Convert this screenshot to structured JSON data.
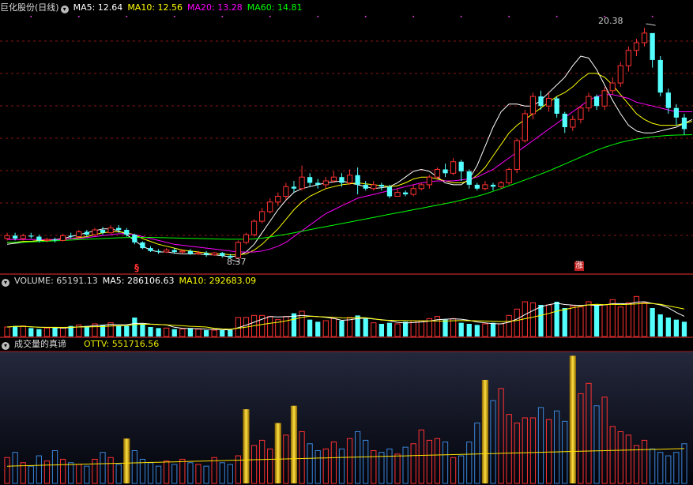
{
  "stock": {
    "name": "巨化股份",
    "period": "(日线)"
  },
  "ma": {
    "ma5": "MA5: 12.64",
    "ma10": "MA10: 12.56",
    "ma20": "MA20: 13.28",
    "ma60": "MA60: 14.81"
  },
  "price_marks": {
    "high": "20.38",
    "low": "8.37",
    "signal_left": "§",
    "signal_right": "涨"
  },
  "volume_panel": {
    "volume": "VOLUME: 65191.13",
    "ma5": "MA5: 286106.63",
    "ma10": "MA10: 292683.09"
  },
  "ind_panel": {
    "title": "成交量的真谛",
    "ottv": "OTTV: 551716.56"
  },
  "colors": {
    "up": "#ff3232",
    "down": "#54ffff",
    "ma5": "#ffffff",
    "ma10": "#ffff00",
    "ma20": "#ff00ff",
    "ma60": "#00ff00",
    "ind_blue": "#3a86d8",
    "ind_gold": "#e8b400"
  },
  "chart_data": [
    {
      "type": "candlestick",
      "ylim": [
        8.0,
        21.0
      ],
      "overlays": [
        {
          "name": "MA5",
          "values": [
            9.1,
            9.15,
            9.2,
            9.25,
            9.3,
            9.3,
            9.35,
            9.4,
            9.5,
            9.6,
            9.7,
            9.8,
            9.9,
            9.9,
            9.8,
            9.6,
            9.3,
            9.0,
            8.8,
            8.7,
            8.7,
            8.65,
            8.6,
            8.6,
            8.6,
            8.55,
            8.55,
            8.5,
            8.45,
            8.5,
            8.7,
            9.1,
            9.7,
            10.3,
            10.9,
            11.4,
            11.8,
            12.0,
            12.1,
            12.2,
            12.3,
            12.35,
            12.4,
            12.3,
            12.2,
            12.1,
            12.0,
            12.05,
            12.1,
            12.3,
            12.6,
            12.9,
            13.0,
            12.9,
            12.6,
            12.3,
            12.2,
            12.2,
            12.5,
            13.2,
            14.2,
            15.2,
            16.0,
            16.4,
            16.4,
            16.3,
            16.3,
            16.6,
            17.0,
            17.4,
            17.8,
            18.4,
            18.9,
            18.8,
            18.2,
            17.4,
            16.6,
            15.9,
            15.3,
            15.0,
            14.9,
            14.9,
            15.0,
            15.1,
            15.2,
            15.4,
            15.6
          ]
        },
        {
          "name": "MA10",
          "values": [
            9.2,
            9.2,
            9.25,
            9.25,
            9.3,
            9.3,
            9.35,
            9.35,
            9.4,
            9.45,
            9.5,
            9.6,
            9.7,
            9.75,
            9.75,
            9.7,
            9.6,
            9.4,
            9.25,
            9.1,
            9.0,
            8.9,
            8.8,
            8.75,
            8.7,
            8.65,
            8.6,
            8.6,
            8.55,
            8.55,
            8.6,
            8.8,
            9.1,
            9.5,
            9.9,
            10.4,
            10.9,
            11.3,
            11.6,
            11.8,
            12.0,
            12.1,
            12.2,
            12.25,
            12.3,
            12.25,
            12.2,
            12.15,
            12.1,
            12.15,
            12.3,
            12.5,
            12.6,
            12.6,
            12.5,
            12.4,
            12.3,
            12.3,
            12.4,
            12.7,
            13.1,
            13.7,
            14.3,
            14.9,
            15.3,
            15.6,
            15.9,
            16.2,
            16.5,
            16.8,
            17.0,
            17.3,
            17.7,
            18.0,
            18.0,
            17.8,
            17.4,
            16.9,
            16.4,
            15.9,
            15.6,
            15.4,
            15.3,
            15.3,
            15.3,
            15.4,
            15.5
          ]
        },
        {
          "name": "MA20",
          "values": [
            9.35,
            9.35,
            9.35,
            9.35,
            9.35,
            9.35,
            9.35,
            9.35,
            9.4,
            9.4,
            9.45,
            9.5,
            9.55,
            9.6,
            9.65,
            9.65,
            9.6,
            9.5,
            9.4,
            9.3,
            9.2,
            9.1,
            9.05,
            9.0,
            8.95,
            8.9,
            8.85,
            8.8,
            8.75,
            8.7,
            8.7,
            8.7,
            8.75,
            8.85,
            9.0,
            9.2,
            9.5,
            9.8,
            10.1,
            10.4,
            10.7,
            10.9,
            11.1,
            11.3,
            11.5,
            11.6,
            11.7,
            11.8,
            11.9,
            12.0,
            12.1,
            12.2,
            12.3,
            12.35,
            12.4,
            12.4,
            12.4,
            12.45,
            12.5,
            12.6,
            12.8,
            13.0,
            13.3,
            13.6,
            13.9,
            14.2,
            14.5,
            14.8,
            15.1,
            15.4,
            15.7,
            16.0,
            16.3,
            16.6,
            16.8,
            16.9,
            16.9,
            16.8,
            16.7,
            16.5,
            16.4,
            16.3,
            16.2,
            16.1,
            16.0,
            16.0,
            16.0
          ]
        },
        {
          "name": "MA60",
          "values": [
            9.2,
            9.2,
            9.2,
            9.22,
            9.24,
            9.26,
            9.28,
            9.3,
            9.32,
            9.34,
            9.36,
            9.38,
            9.4,
            9.42,
            9.44,
            9.45,
            9.46,
            9.46,
            9.46,
            9.45,
            9.44,
            9.43,
            9.42,
            9.41,
            9.4,
            9.39,
            9.38,
            9.37,
            9.36,
            9.36,
            9.36,
            9.38,
            9.42,
            9.48,
            9.55,
            9.62,
            9.7,
            9.78,
            9.86,
            9.94,
            10.02,
            10.1,
            10.18,
            10.26,
            10.34,
            10.42,
            10.5,
            10.58,
            10.66,
            10.74,
            10.82,
            10.9,
            10.98,
            11.06,
            11.14,
            11.22,
            11.3,
            11.4,
            11.5,
            11.6,
            11.72,
            11.86,
            12.0,
            12.15,
            12.3,
            12.45,
            12.6,
            12.76,
            12.92,
            13.1,
            13.28,
            13.46,
            13.64,
            13.82,
            14.0,
            14.15,
            14.28,
            14.4,
            14.5,
            14.58,
            14.64,
            14.7,
            14.74,
            14.77,
            14.79,
            14.8,
            14.81
          ]
        }
      ],
      "candles": [
        [
          9.4,
          9.55,
          9.7,
          9.3
        ],
        [
          9.55,
          9.4,
          9.7,
          9.3
        ],
        [
          9.4,
          9.55,
          9.65,
          9.3
        ],
        [
          9.55,
          9.5,
          9.7,
          9.4
        ],
        [
          9.5,
          9.3,
          9.6,
          9.2
        ],
        [
          9.3,
          9.35,
          9.45,
          9.2
        ],
        [
          9.35,
          9.3,
          9.45,
          9.2
        ],
        [
          9.3,
          9.55,
          9.65,
          9.25
        ],
        [
          9.55,
          9.5,
          9.7,
          9.4
        ],
        [
          9.5,
          9.75,
          9.85,
          9.45
        ],
        [
          9.75,
          9.6,
          9.85,
          9.5
        ],
        [
          9.6,
          9.85,
          9.95,
          9.55
        ],
        [
          9.85,
          9.7,
          10.0,
          9.6
        ],
        [
          9.7,
          9.95,
          10.1,
          9.65
        ],
        [
          9.95,
          9.85,
          10.1,
          9.7
        ],
        [
          9.85,
          9.6,
          9.95,
          9.5
        ],
        [
          9.6,
          9.2,
          9.65,
          9.1
        ],
        [
          9.2,
          8.9,
          9.25,
          8.85
        ],
        [
          8.9,
          8.75,
          9.0,
          8.7
        ],
        [
          8.75,
          8.7,
          8.85,
          8.6
        ],
        [
          8.7,
          8.8,
          8.9,
          8.65
        ],
        [
          8.8,
          8.7,
          8.9,
          8.6
        ],
        [
          8.7,
          8.75,
          8.85,
          8.6
        ],
        [
          8.75,
          8.6,
          8.85,
          8.55
        ],
        [
          8.6,
          8.65,
          8.75,
          8.55
        ],
        [
          8.65,
          8.55,
          8.75,
          8.45
        ],
        [
          8.55,
          8.65,
          8.7,
          8.5
        ],
        [
          8.65,
          8.5,
          8.7,
          8.4
        ],
        [
          8.5,
          8.4,
          8.6,
          8.37
        ],
        [
          8.4,
          9.2,
          9.3,
          8.4
        ],
        [
          9.2,
          9.6,
          9.7,
          9.1
        ],
        [
          9.6,
          10.3,
          10.4,
          9.5
        ],
        [
          10.3,
          10.8,
          11.0,
          10.2
        ],
        [
          10.8,
          11.3,
          11.5,
          10.7
        ],
        [
          11.3,
          11.6,
          11.8,
          11.1
        ],
        [
          11.6,
          12.1,
          12.3,
          11.4
        ],
        [
          12.1,
          12.0,
          12.4,
          11.8
        ],
        [
          12.0,
          12.6,
          13.2,
          11.9
        ],
        [
          12.6,
          12.3,
          12.8,
          12.1
        ],
        [
          12.3,
          12.2,
          12.5,
          12.0
        ],
        [
          12.2,
          12.4,
          12.6,
          12.0
        ],
        [
          12.4,
          12.6,
          12.9,
          12.3
        ],
        [
          12.6,
          12.3,
          12.8,
          12.1
        ],
        [
          12.3,
          12.7,
          13.0,
          12.2
        ],
        [
          12.7,
          12.2,
          13.1,
          11.7
        ],
        [
          12.2,
          12.0,
          12.4,
          11.9
        ],
        [
          12.0,
          12.2,
          12.4,
          11.9
        ],
        [
          12.2,
          12.1,
          12.3,
          11.9
        ],
        [
          12.1,
          11.6,
          12.2,
          11.5
        ],
        [
          11.6,
          11.8,
          12.0,
          11.6
        ],
        [
          11.8,
          11.7,
          11.9,
          11.6
        ],
        [
          11.7,
          12.0,
          12.2,
          11.6
        ],
        [
          12.0,
          12.2,
          12.3,
          11.9
        ],
        [
          12.2,
          12.6,
          12.7,
          12.0
        ],
        [
          12.6,
          13.0,
          13.1,
          12.5
        ],
        [
          13.0,
          12.8,
          13.3,
          12.6
        ],
        [
          12.8,
          13.4,
          13.6,
          12.7
        ],
        [
          13.4,
          12.9,
          13.5,
          12.4
        ],
        [
          12.9,
          12.2,
          13.0,
          12.0
        ],
        [
          12.2,
          12.0,
          12.3,
          11.9
        ],
        [
          12.0,
          12.2,
          12.4,
          11.9
        ],
        [
          12.2,
          12.1,
          12.3,
          11.9
        ],
        [
          12.1,
          12.3,
          12.4,
          12.0
        ],
        [
          12.3,
          13.0,
          13.1,
          12.2
        ],
        [
          13.0,
          14.5,
          14.6,
          12.8
        ],
        [
          14.5,
          15.9,
          16.1,
          14.4
        ],
        [
          15.9,
          16.8,
          17.0,
          15.6
        ],
        [
          16.8,
          16.3,
          17.1,
          16.1
        ],
        [
          16.3,
          16.7,
          17.0,
          16.0
        ],
        [
          16.7,
          15.9,
          16.8,
          15.7
        ],
        [
          15.9,
          15.2,
          16.0,
          14.9
        ],
        [
          15.2,
          15.6,
          15.8,
          15.0
        ],
        [
          15.6,
          16.2,
          16.3,
          15.4
        ],
        [
          16.2,
          16.8,
          17.0,
          16.0
        ],
        [
          16.8,
          16.3,
          16.9,
          16.1
        ],
        [
          16.3,
          17.1,
          17.3,
          16.1
        ],
        [
          17.1,
          17.5,
          17.8,
          16.9
        ],
        [
          17.5,
          18.4,
          18.6,
          17.3
        ],
        [
          18.4,
          19.2,
          19.4,
          18.1
        ],
        [
          19.2,
          19.6,
          19.8,
          18.9
        ],
        [
          19.6,
          20.1,
          20.38,
          19.4
        ],
        [
          20.1,
          18.7,
          19.4,
          18.3
        ],
        [
          18.7,
          17.0,
          18.9,
          16.8
        ],
        [
          17.0,
          16.2,
          17.2,
          15.9
        ],
        [
          16.2,
          15.7,
          16.4,
          15.3
        ],
        [
          15.7,
          15.1,
          15.9,
          14.8
        ]
      ]
    },
    {
      "type": "bar",
      "series": [
        {
          "name": "VOLUME",
          "values": [
            0.9,
            1.0,
            1.0,
            0.8,
            0.7,
            0.8,
            0.9,
            0.8,
            1.0,
            1.1,
            1.0,
            1.2,
            1.1,
            1.3,
            1.0,
            1.0,
            1.8,
            1.2,
            0.9,
            0.8,
            0.8,
            0.7,
            0.7,
            0.8,
            0.7,
            0.6,
            0.6,
            0.6,
            0.6,
            1.8,
            1.8,
            2.0,
            2.0,
            1.9,
            1.6,
            1.9,
            2.2,
            2.4,
            1.6,
            1.4,
            1.5,
            1.7,
            1.5,
            1.8,
            2.0,
            1.7,
            1.3,
            1.2,
            1.3,
            1.2,
            1.4,
            1.5,
            1.5,
            1.7,
            1.9,
            1.6,
            1.7,
            1.3,
            1.2,
            1.1,
            1.2,
            1.3,
            1.2,
            2.0,
            2.6,
            3.3,
            3.2,
            3.0,
            3.0,
            3.3,
            2.7,
            2.9,
            2.8,
            3.3,
            3.0,
            3.0,
            3.5,
            2.8,
            3.2,
            3.8,
            3.2,
            2.7,
            2.1,
            1.8,
            1.6,
            1.4
          ]
        }
      ],
      "ylim": [
        0,
        4.5
      ]
    },
    {
      "type": "bar",
      "series": [
        {
          "name": "OTTV",
          "values": [
            1.5,
            1.8,
            1.2,
            1.0,
            1.6,
            1.3,
            1.9,
            1.4,
            1.2,
            1.1,
            1.0,
            1.4,
            1.8,
            1.5,
            1.1,
            2.6,
            1.9,
            1.4,
            1.2,
            1.0,
            1.3,
            1.1,
            1.4,
            1.2,
            1.1,
            1.0,
            1.5,
            1.2,
            1.1,
            1.6,
            4.3,
            2.2,
            2.5,
            2.0,
            3.5,
            2.8,
            4.5,
            3.0,
            2.3,
            1.9,
            2.0,
            2.4,
            2.0,
            2.6,
            3.0,
            2.5,
            1.9,
            1.8,
            2.0,
            1.7,
            2.1,
            2.3,
            3.1,
            2.5,
            2.6,
            2.4,
            1.5,
            1.6,
            2.4,
            3.5,
            6.0,
            4.8,
            5.5,
            4.0,
            3.5,
            3.8,
            3.8,
            4.4,
            3.7,
            4.2,
            3.6,
            7.4,
            5.2,
            5.8,
            4.5,
            5.0,
            3.3,
            3.0,
            2.8,
            2.2,
            2.5,
            2.0,
            1.8,
            1.6,
            1.8,
            2.3
          ]
        }
      ],
      "ylim": [
        0,
        7.6
      ]
    }
  ]
}
